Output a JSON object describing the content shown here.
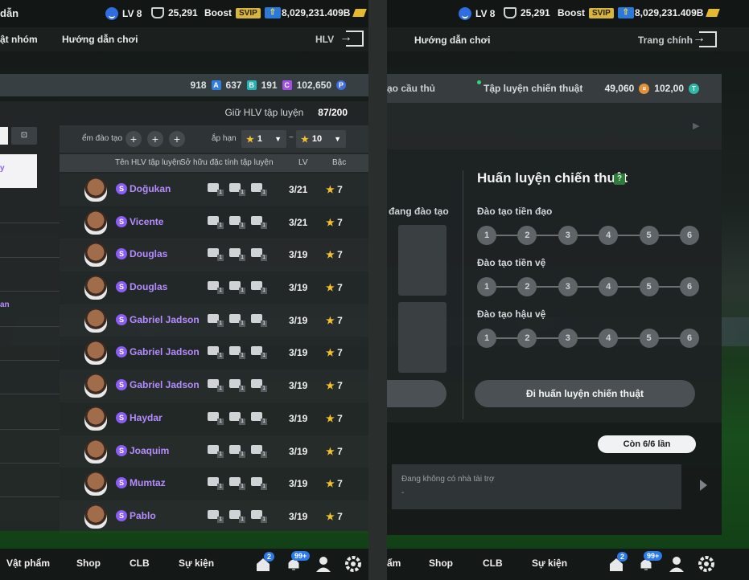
{
  "left": {
    "top": {
      "title_fragment": "dẫn",
      "level": "LV 8",
      "trophies": "25,291",
      "boost_label": "Boost",
      "svip": "SVIP",
      "money": "8,029,231.409B"
    },
    "nav": {
      "item1": "ật nhóm",
      "item2": "Hướng dẫn chơi",
      "right_label": "HLV"
    },
    "currency": {
      "v1": "918",
      "l1": "A",
      "v2": "637",
      "l2": "B",
      "v3": "191",
      "l3": "C",
      "v4": "102,650",
      "l4": "P"
    },
    "keep": {
      "label": "Giữ HLV tập luyện",
      "value": "87/200"
    },
    "filter": {
      "train_label": "ểm đào tạo",
      "rank_label": "ắp hạn",
      "min": "1",
      "max": "10",
      "tilde": "~"
    },
    "columns": {
      "name": "Tên HLV tập luyện",
      "traits": "Sở hữu đặc tính tập luyện",
      "lv": "LV",
      "grade": "Bậc"
    },
    "side_texts": {
      "s1": "y",
      "s2": "an"
    },
    "coaches": [
      {
        "name": "Doğukan",
        "lv": "3/21",
        "grade": "7"
      },
      {
        "name": "Vicente",
        "lv": "3/21",
        "grade": "7"
      },
      {
        "name": "Douglas",
        "lv": "3/19",
        "grade": "7"
      },
      {
        "name": "Douglas",
        "lv": "3/19",
        "grade": "7"
      },
      {
        "name": "Gabriel Jadson",
        "lv": "3/19",
        "grade": "7"
      },
      {
        "name": "Gabriel Jadson",
        "lv": "3/19",
        "grade": "7"
      },
      {
        "name": "Gabriel Jadson",
        "lv": "3/19",
        "grade": "7"
      },
      {
        "name": "Haydar",
        "lv": "3/19",
        "grade": "7"
      },
      {
        "name": "Joaquim",
        "lv": "3/19",
        "grade": "7"
      },
      {
        "name": "Mumtaz",
        "lv": "3/19",
        "grade": "7"
      },
      {
        "name": "Pablo",
        "lv": "3/19",
        "grade": "7"
      }
    ],
    "bottom": {
      "b1": "Vật phẩm",
      "b2": "Shop",
      "b3": "CLB",
      "b4": "Sự kiện",
      "badge_home": "2",
      "badge_bell": "99+"
    }
  },
  "right": {
    "top": {
      "level": "LV 8",
      "trophies": "25,291",
      "boost_label": "Boost",
      "svip": "SVIP",
      "money": "8,029,231.409B"
    },
    "nav": {
      "item1": "Hướng dẫn chơi",
      "right_label": "Trang chính"
    },
    "tabs": {
      "t1": "ạo cầu thủ",
      "t2": "Tập luyện chiến thuật"
    },
    "currency": {
      "v1": "49,060",
      "v2": "102,00"
    },
    "training_label": "đang đào tạo",
    "tactic": {
      "title": "Huấn luyện chiến thuật",
      "help": "?",
      "tracks": [
        {
          "label": "Đào tạo tiền đạo",
          "nodes": [
            "1",
            "2",
            "3",
            "4",
            "5",
            "6"
          ]
        },
        {
          "label": "Đào tạo tiền vệ",
          "nodes": [
            "1",
            "2",
            "3",
            "4",
            "5",
            "6"
          ]
        },
        {
          "label": "Đào tạo hậu vệ",
          "nodes": [
            "1",
            "2",
            "3",
            "4",
            "5",
            "6"
          ]
        }
      ],
      "button": "Đi huấn luyện chiến thuật"
    },
    "remain": "Còn 6/6 lần",
    "sponsor": {
      "title": "Đang không có nhà tài trợ",
      "dash": "-"
    },
    "bottom": {
      "b1": "ẩm",
      "b2": "Shop",
      "b3": "CLB",
      "b4": "Sự kiện",
      "badge_home": "2",
      "badge_bell": "99+"
    }
  },
  "colors": {
    "purple_name": "#b58cff",
    "star": "#f3c22c",
    "svip": "#d8b53c",
    "panel": "#222627"
  }
}
